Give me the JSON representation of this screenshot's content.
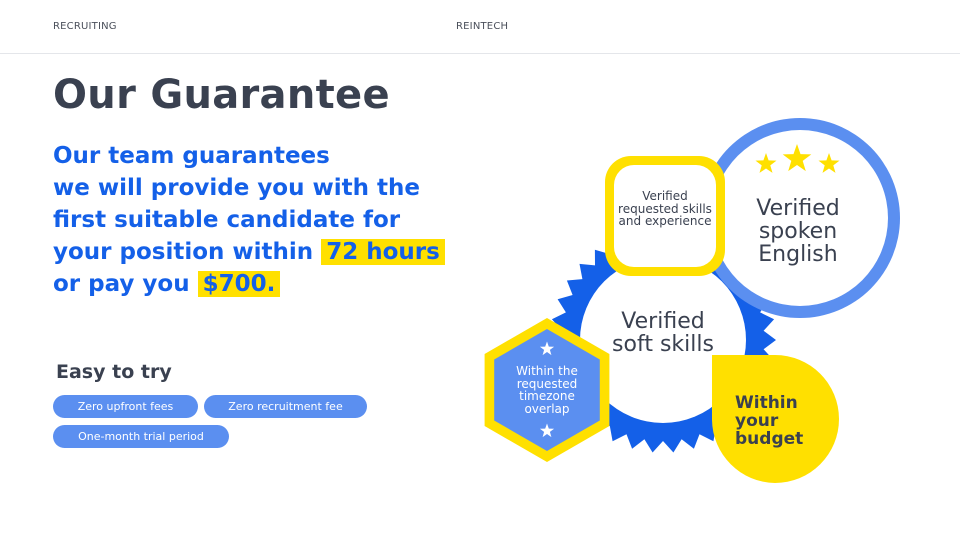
{
  "nav": {
    "left": "RECRUITING",
    "center": "REINTECH"
  },
  "title": "Our Guarantee",
  "headline": {
    "line1": "Our team guarantees",
    "line2": "we will provide you with the",
    "line3": "first suitable candidate for",
    "line4_text": "your position within",
    "line4_highlight": "72 hours",
    "line5_text": "or pay you",
    "line5_highlight": "$700."
  },
  "easy": {
    "title": "Easy to try",
    "pills": [
      "Zero upfront fees",
      "Zero recruitment fee",
      "One-month trial period"
    ]
  },
  "graphic": {
    "skills": "Verified requested skills and experience",
    "english": "Verified spoken English",
    "soft": "Verified soft skills",
    "timezone": "Within the requested timezone overlap",
    "budget": "Within your budget"
  },
  "colors": {
    "blue": "#1460e8",
    "light_blue": "#5b8ff0",
    "yellow": "#ffe000",
    "dark": "#3a4150"
  }
}
